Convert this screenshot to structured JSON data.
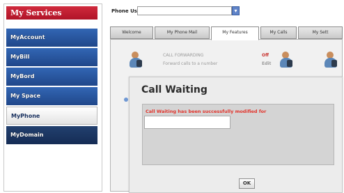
{
  "sidebar": {
    "header": "My Services",
    "items": [
      {
        "label": "MyAccount"
      },
      {
        "label": "MyBill"
      },
      {
        "label": "MyBord"
      },
      {
        "label": "My Space"
      },
      {
        "label": "MyPhone"
      },
      {
        "label": "MyDomain"
      }
    ],
    "active_index": 4
  },
  "top": {
    "phone_user_label": "Phone User:",
    "phone_user_value": "",
    "dropdown_icon": "chevron-down-icon"
  },
  "tabs": [
    {
      "label": "Welcome"
    },
    {
      "label": "My Phone Mail"
    },
    {
      "label": "My Features"
    },
    {
      "label": "My Calls"
    },
    {
      "label": "My Sett"
    }
  ],
  "features": {
    "left_title": "CALL FORWARDING",
    "left_sub": "Forward calls to a number",
    "left_value": "Off",
    "left_value2": "Edit"
  },
  "dialog": {
    "title": "Call Waiting",
    "message": "Call Waiting has been successfully modified for",
    "ok_label": "OK"
  },
  "colors": {
    "header_red": "#c21c31",
    "nav_blue": "#2a56a0",
    "message_red": "#e2332b"
  }
}
